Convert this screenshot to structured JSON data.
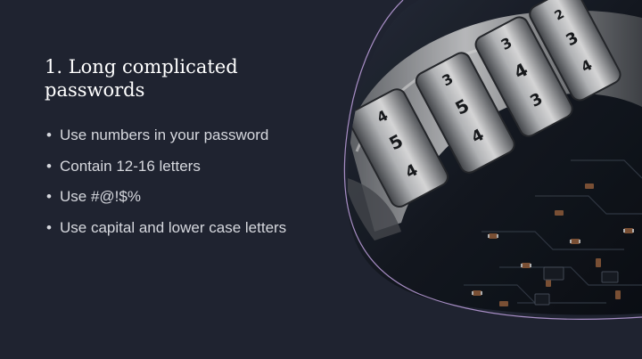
{
  "slide": {
    "title": "1. Long complicated passwords",
    "bullets": [
      "Use numbers in your password",
      "Contain 12-16 letters",
      "Use #@!$%",
      "Use capital and lower case letters"
    ],
    "photo": {
      "icon": "combination-lock-image",
      "dial_digits": [
        "4",
        "5",
        "4",
        "3",
        "5",
        "4",
        "3",
        "4",
        "3",
        "2",
        "3",
        "4"
      ]
    }
  },
  "colors": {
    "background": "#1f2330",
    "title": "#ffffff",
    "body_text": "#d6d8de",
    "accent_curve": "#b79ad6"
  }
}
